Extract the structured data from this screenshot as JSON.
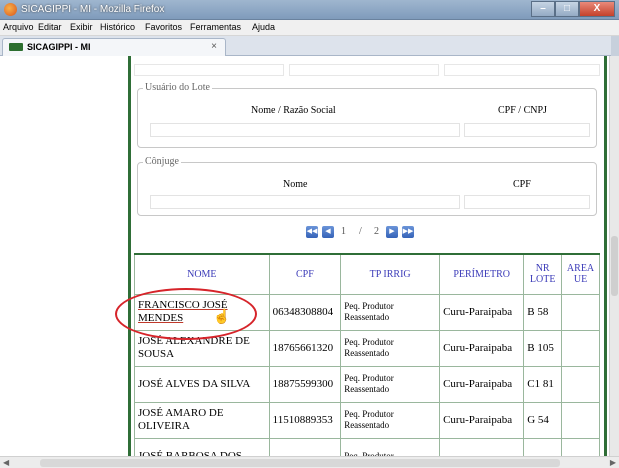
{
  "window": {
    "title": "SICAGIPPI - MI - Mozilla Firefox",
    "minimize": "–",
    "maximize": "□",
    "close": "X"
  },
  "menu": {
    "items": [
      "Arquivo",
      "Editar",
      "Exibir",
      "Histórico",
      "Favoritos",
      "Ferramentas",
      "Ajuda"
    ]
  },
  "tab": {
    "label": "SICAGIPPI - MI",
    "close": "×"
  },
  "usuario_lote": {
    "legend": "Usuário do Lote",
    "col1": "Nome / Razão Social",
    "col2": "CPF / CNPJ"
  },
  "conjuge": {
    "legend": "Cônjuge",
    "col1": "Nome",
    "col2": "CPF"
  },
  "pager": {
    "page1": "1",
    "separator": "/",
    "page2": "2"
  },
  "table": {
    "headers": [
      "NOME",
      "CPF",
      "TP IRRIG",
      "PERÍMETRO",
      "NR LOTE",
      "AREA UE"
    ],
    "rows": [
      {
        "nome": "FRANCISCO JOSÉ MENDES",
        "cpf": "06348308804",
        "tp_irrig": "Peq. Produtor Reassentado",
        "perimetro": "Curu-Paraipaba",
        "nr_lote": "B 58",
        "area": ""
      },
      {
        "nome": "JOSÉ ALEXANDRE DE SOUSA",
        "cpf": "18765661320",
        "tp_irrig": "Peq. Produtor Reassentado",
        "perimetro": "Curu-Paraipaba",
        "nr_lote": "B 105",
        "area": ""
      },
      {
        "nome": "JOSÉ ALVES DA SILVA",
        "cpf": "18875599300",
        "tp_irrig": "Peq. Produtor Reassentado",
        "perimetro": "Curu-Paraipaba",
        "nr_lote": "C1 81",
        "area": ""
      },
      {
        "nome": "JOSÉ AMARO DE OLIVEIRA",
        "cpf": "11510889353",
        "tp_irrig": "Peq. Produtor Reassentado",
        "perimetro": "Curu-Paraipaba",
        "nr_lote": "G 54",
        "area": ""
      },
      {
        "nome": "JOSÉ BARBOSA DOS",
        "cpf": "",
        "tp_irrig": "Peq. Produtor",
        "perimetro": "",
        "nr_lote": "",
        "area": ""
      }
    ]
  },
  "colors": {
    "frame_green": "#2f6e37",
    "header_text_blue": "#3b3bb8",
    "highlight_red": "#d6242a"
  }
}
